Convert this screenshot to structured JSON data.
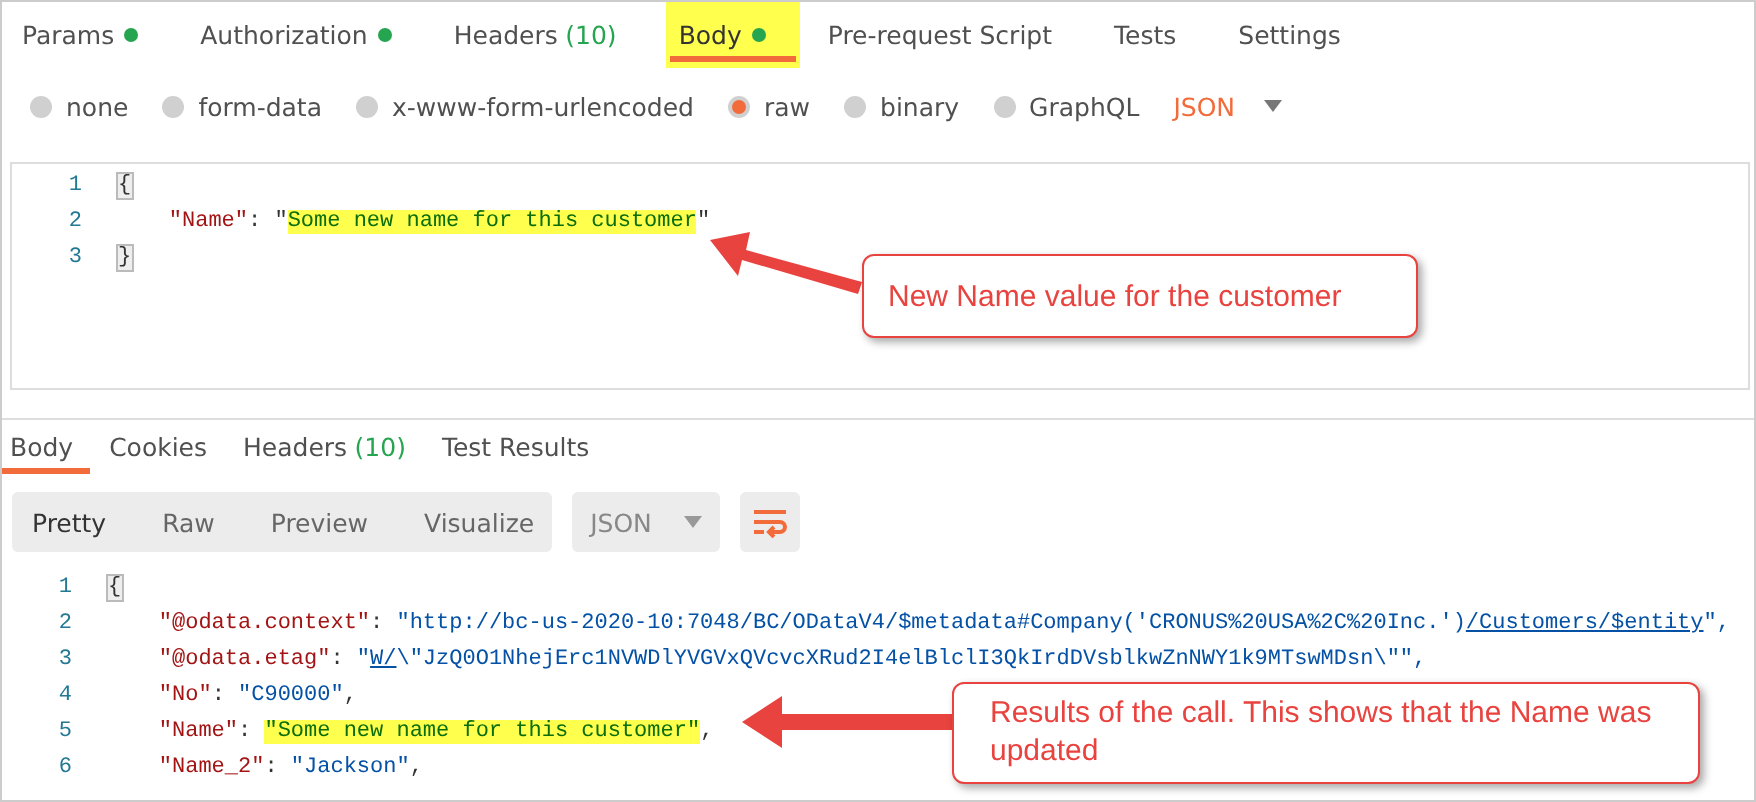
{
  "request_tabs": [
    {
      "label": "Params",
      "dot": true,
      "selected": false,
      "highlighted": false
    },
    {
      "label": "Authorization",
      "dot": true,
      "selected": false,
      "highlighted": false
    },
    {
      "label": "Headers",
      "count": "(10)",
      "dot": false,
      "selected": false,
      "highlighted": false
    },
    {
      "label": "Body",
      "dot": true,
      "selected": true,
      "highlighted": true
    },
    {
      "label": "Pre-request Script",
      "dot": false,
      "selected": false,
      "highlighted": false
    },
    {
      "label": "Tests",
      "dot": false,
      "selected": false,
      "highlighted": false
    },
    {
      "label": "Settings",
      "dot": false,
      "selected": false,
      "highlighted": false
    }
  ],
  "body_types": [
    {
      "label": "none",
      "selected": false
    },
    {
      "label": "form-data",
      "selected": false
    },
    {
      "label": "x-www-form-urlencoded",
      "selected": false
    },
    {
      "label": "raw",
      "selected": true
    },
    {
      "label": "binary",
      "selected": false
    },
    {
      "label": "GraphQL",
      "selected": false
    }
  ],
  "raw_format": "JSON",
  "request_editor": {
    "lines": [
      {
        "number": "1",
        "segments": [
          {
            "text": "{",
            "kind": "brace"
          }
        ]
      },
      {
        "number": "2",
        "segments": [
          {
            "text": "    \"Name\"",
            "kind": "key"
          },
          {
            "text": ": \"",
            "kind": "punct"
          },
          {
            "text": "Some new name for this customer",
            "kind": "string",
            "highlight": true
          },
          {
            "text": "\"",
            "kind": "punct"
          }
        ]
      },
      {
        "number": "3",
        "segments": [
          {
            "text": "}",
            "kind": "brace"
          }
        ]
      }
    ]
  },
  "callout_1": "New Name value for the customer",
  "response_tabs": [
    {
      "label": "Body",
      "selected": true
    },
    {
      "label": "Cookies",
      "selected": false
    },
    {
      "label": "Headers",
      "count": "(10)",
      "selected": false
    },
    {
      "label": "Test Results",
      "selected": false
    }
  ],
  "view_modes": [
    {
      "label": "Pretty",
      "selected": true
    },
    {
      "label": "Raw",
      "selected": false
    },
    {
      "label": "Preview",
      "selected": false
    },
    {
      "label": "Visualize",
      "selected": false
    }
  ],
  "response_format": "JSON",
  "response_editor": {
    "lines": [
      {
        "number": "1",
        "segments": [
          {
            "text": "{",
            "kind": "brace"
          }
        ]
      },
      {
        "number": "2",
        "segments": [
          {
            "text": "    \"@odata.context\"",
            "kind": "key"
          },
          {
            "text": ": ",
            "kind": "punct"
          },
          {
            "text": "\"http://bc-us-2020-10:7048/BC/ODataV4/$metadata#Company('CRONUS%20USA%2C%20Inc.')",
            "kind": "string"
          },
          {
            "text": "/Customers/$entity",
            "kind": "link"
          },
          {
            "text": "\",",
            "kind": "string"
          }
        ]
      },
      {
        "number": "3",
        "segments": [
          {
            "text": "    \"@odata.etag\"",
            "kind": "key"
          },
          {
            "text": ": ",
            "kind": "punct"
          },
          {
            "text": "\"",
            "kind": "string"
          },
          {
            "text": "W/",
            "kind": "link"
          },
          {
            "text": "\\\"JzQ0O1NhejErc1NVWDlYVGVxQVcvcXRud2I4elBlclI3QkIrdDVsblkwZnNWY1k9MTswMDsn\\\"\",",
            "kind": "string"
          }
        ]
      },
      {
        "number": "4",
        "segments": [
          {
            "text": "    \"No\"",
            "kind": "key"
          },
          {
            "text": ": ",
            "kind": "punct"
          },
          {
            "text": "\"C90000\"",
            "kind": "string"
          },
          {
            "text": ",",
            "kind": "punct"
          }
        ]
      },
      {
        "number": "5",
        "segments": [
          {
            "text": "    \"Name\"",
            "kind": "key"
          },
          {
            "text": ": ",
            "kind": "punct"
          },
          {
            "text": "\"Some new name for this customer\"",
            "kind": "string",
            "highlight": true
          },
          {
            "text": ",",
            "kind": "punct"
          }
        ]
      },
      {
        "number": "6",
        "segments": [
          {
            "text": "    \"Name_2\"",
            "kind": "key"
          },
          {
            "text": ": ",
            "kind": "punct"
          },
          {
            "text": "\"Jackson\"",
            "kind": "string"
          },
          {
            "text": ",",
            "kind": "punct"
          }
        ]
      }
    ]
  },
  "callout_2": "Results of the call. This shows that the Name was updated"
}
